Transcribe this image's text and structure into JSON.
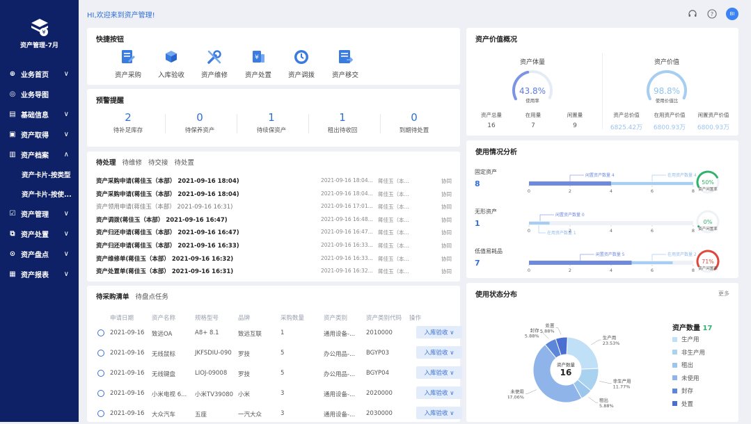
{
  "sidebar": {
    "title": "资产管理-7月",
    "items": [
      {
        "label": "业务首页",
        "chev": "∨"
      },
      {
        "label": "业务导图",
        "chev": ""
      },
      {
        "label": "基础信息",
        "chev": "∨"
      },
      {
        "label": "资产取得",
        "chev": "∨"
      },
      {
        "label": "资产档案",
        "chev": "∧"
      },
      {
        "label": "资产管理",
        "chev": "∨"
      },
      {
        "label": "资产处置",
        "chev": "∨"
      },
      {
        "label": "资产盘点",
        "chev": "∨"
      },
      {
        "label": "资产报表",
        "chev": "∨"
      }
    ],
    "subitems": [
      "资产卡片-按类型",
      "资产卡片-按使..."
    ]
  },
  "header": {
    "welcome": "HI,欢迎来到资产管理!",
    "avatar": "BI"
  },
  "quick": {
    "title": "快捷按钮",
    "buttons": [
      {
        "label": "资产采购",
        "icon": "purchase-icon"
      },
      {
        "label": "入库验收",
        "icon": "warehouse-icon"
      },
      {
        "label": "资产维修",
        "icon": "repair-icon"
      },
      {
        "label": "资产处置",
        "icon": "dispose-icon"
      },
      {
        "label": "资产调拨",
        "icon": "transfer-icon"
      },
      {
        "label": "资产移交",
        "icon": "handover-icon"
      }
    ]
  },
  "warning": {
    "title": "预警提醒",
    "items": [
      {
        "num": "2",
        "label": "待补足库存"
      },
      {
        "num": "0",
        "label": "待保养资产"
      },
      {
        "num": "1",
        "label": "待续保资产"
      },
      {
        "num": "1",
        "label": "租出待收回"
      },
      {
        "num": "0",
        "label": "到期待处置"
      }
    ]
  },
  "todo": {
    "tabs": [
      "待处理",
      "待维修",
      "待交接",
      "待处置"
    ],
    "rows": [
      {
        "title": "资产采购申请(蒋佳玉（本部） 2021-09-16 18:04)",
        "date": "2021-09-16 18:04...",
        "person": "蒋佳玉（本...",
        "action": "协同",
        "dim": false
      },
      {
        "title": "资产采购申请(蒋佳玉（本部） 2021-09-16 18:04)",
        "date": "2021-09-16 18:04...",
        "person": "蒋佳玉（本...",
        "action": "协同",
        "dim": false
      },
      {
        "title": "资产领用申请(蒋佳玉（本部） 2021-09-16 16:31)",
        "date": "2021-09-16 17:01...",
        "person": "蒋佳玉（本...",
        "action": "协同",
        "dim": true
      },
      {
        "title": "资产调拨(蒋佳玉（本部） 2021-09-16 16:47)",
        "date": "2021-09-16 16:48...",
        "person": "蒋佳玉（本...",
        "action": "协同",
        "dim": false
      },
      {
        "title": "资产归还申请(蒋佳玉（本部） 2021-09-16 16:47)",
        "date": "2021-09-16 16:47...",
        "person": "蒋佳玉（本...",
        "action": "协同",
        "dim": false
      },
      {
        "title": "资产归还申请(蒋佳玉（本部） 2021-09-16 16:33)",
        "date": "2021-09-16 16:33...",
        "person": "蒋佳玉（本...",
        "action": "协同",
        "dim": false
      },
      {
        "title": "资产维修单(蒋佳玉（本部） 2021-09-16 16:32)",
        "date": "2021-09-16 16:33...",
        "person": "蒋佳玉（本...",
        "action": "协同",
        "dim": false
      },
      {
        "title": "资产处置单(蒋佳玉（本部） 2021-09-16 16:31)",
        "date": "2021-09-16 16:32...",
        "person": "蒋佳玉（本...",
        "action": "协同",
        "dim": false
      }
    ]
  },
  "purchase": {
    "tabs": [
      "待采购清单",
      "待盘点任务"
    ],
    "headers": [
      "申请日期",
      "资产名称",
      "规格型号",
      "品牌",
      "采购数量",
      "资产类别",
      "资产类别代码",
      "操作"
    ],
    "rows": [
      [
        "2021-09-16",
        "致远OA",
        "A8+ 8.1",
        "致远互联",
        "1",
        "通用设备-...",
        "2010000",
        "入库验收 ∨"
      ],
      [
        "2021-09-16",
        "无线鼠标",
        "JKFSDIU-090",
        "罗技",
        "5",
        "办公用品-...",
        "BGYP03",
        "入库验收 ∨"
      ],
      [
        "2021-09-16",
        "无线键盘",
        "LIOJ-09008",
        "罗技",
        "5",
        "办公用品-...",
        "BGYP04",
        "入库验收 ∨"
      ],
      [
        "2021-09-16",
        "小米电视 6...",
        "小米TV39080",
        "小米",
        "3",
        "通用设备-...",
        "2020000",
        "入库验收 ∨"
      ],
      [
        "2021-09-16",
        "大众汽车",
        "五座",
        "一汽大众",
        "3",
        "通用设备-...",
        "2030000",
        "入库验收 ∨"
      ]
    ]
  },
  "value": {
    "title": "资产价值概况",
    "left": {
      "title": "资产体量",
      "percent": "43.8%",
      "sub": "使用率",
      "ratio": 0.438,
      "stats": [
        {
          "label": "资产总量",
          "value": "16"
        },
        {
          "label": "在用量",
          "value": "7"
        },
        {
          "label": "闲置量",
          "value": "9"
        }
      ]
    },
    "right": {
      "title": "资产价值",
      "percent": "98.8%",
      "sub": "使用价值比",
      "ratio": 0.988,
      "stats": [
        {
          "label": "资产总价值",
          "value": "6825.42万"
        },
        {
          "label": "在用资产价值",
          "value": "6800.93万"
        },
        {
          "label": "闲置资产价值",
          "value": "6800.93万"
        }
      ]
    }
  },
  "usage": {
    "title": "使用情况分析",
    "ticks": [
      "0",
      "2",
      "4",
      "6",
      "8"
    ],
    "rows": [
      {
        "label": "固定资产",
        "value": "8",
        "idle": 4,
        "used": 4,
        "ann1": "闲置资产数量 4",
        "ann2": "在用资产数量 4",
        "pct": "50%",
        "pct_val": 0.5,
        "ring_label": "资产闲置率",
        "color": "#2fb36b"
      },
      {
        "label": "无形资产",
        "value": "1",
        "idle": 0,
        "used": 1,
        "ann1": "闲置资产数量 0",
        "ann2": "在用资产数量 1",
        "pct": "0%",
        "pct_val": 0.0,
        "ring_label": "资产闲置率",
        "color": "#2fb36b"
      },
      {
        "label": "低值易耗品",
        "value": "7",
        "idle": 5,
        "used": 2,
        "ann1": "闲置资产数量 5",
        "ann2": "在用资产数量 2",
        "pct": "71%",
        "pct_val": 0.71,
        "ring_label": "资产闲置率",
        "color": "#e0473a"
      }
    ]
  },
  "status": {
    "title": "使用状态分布",
    "more": "更多",
    "center_label": "资产数量",
    "center_value": "16",
    "legend_title": "资产数量",
    "legend_total": "17",
    "legend": [
      "生产用",
      "非生产用",
      "租出",
      "未使用",
      "封存",
      "处置"
    ]
  },
  "chart_data": {
    "type": "pie",
    "title": "使用状态分布",
    "labels": [
      "生产用",
      "非生产用",
      "租出",
      "未使用",
      "封存",
      "处置"
    ],
    "values": [
      23.53,
      11.77,
      5.88,
      47.06,
      5.88,
      5.88
    ],
    "colors": [
      "#bfe0f7",
      "#a9d2f1",
      "#9dc6ec",
      "#8fb4ea",
      "#5b86d9",
      "#4a6fd0"
    ]
  }
}
